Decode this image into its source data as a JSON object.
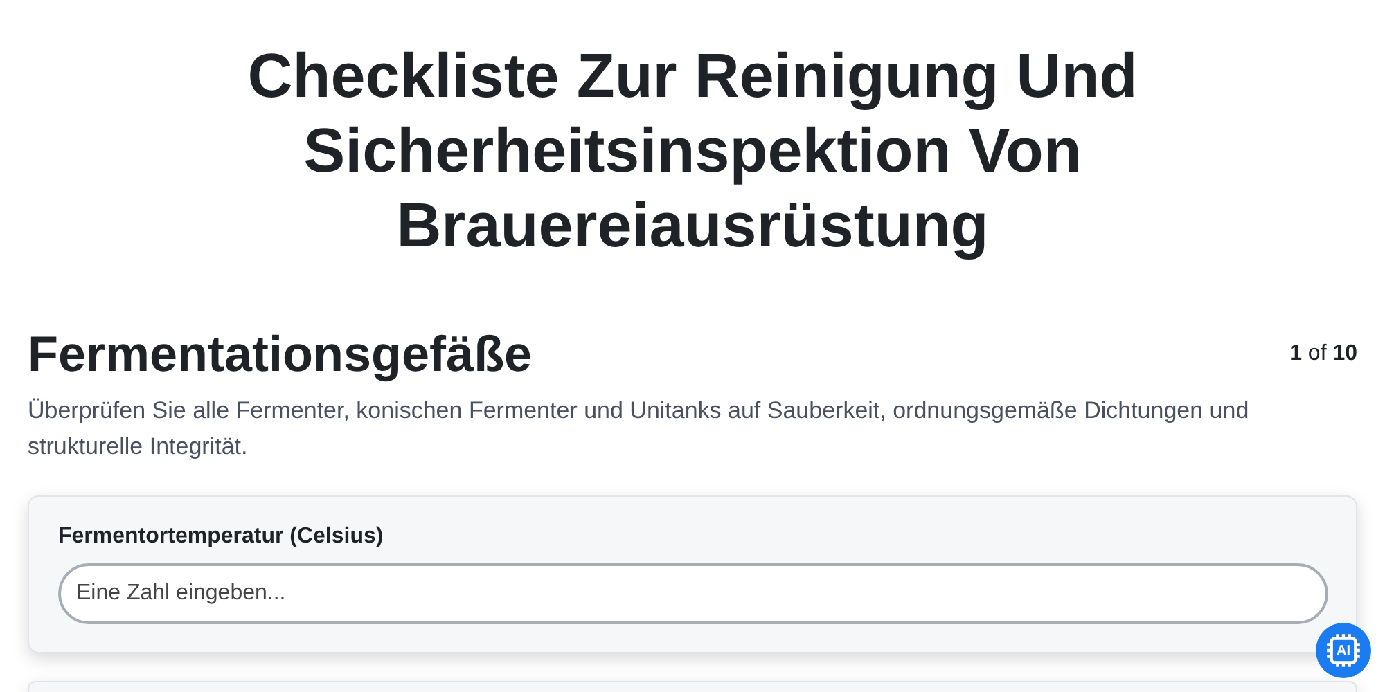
{
  "title": "Checkliste Zur Reinigung Und Sicherheitsinspektion Von Brauereiausrüstung",
  "section": {
    "heading": "Fermentationsgefäße",
    "progress": "**1** of **10**",
    "description": "Überprüfen Sie alle Fermenter, konischen Fermenter und Unitanks auf Sauberkeit, ordnungsgemäße Dichtungen und strukturelle Integrität."
  },
  "fields": [
    {
      "label": "Fermentortemperatur (Celsius)",
      "placeholder": "Eine Zahl eingeben..."
    }
  ],
  "ai_button": {
    "label": "AI"
  }
}
